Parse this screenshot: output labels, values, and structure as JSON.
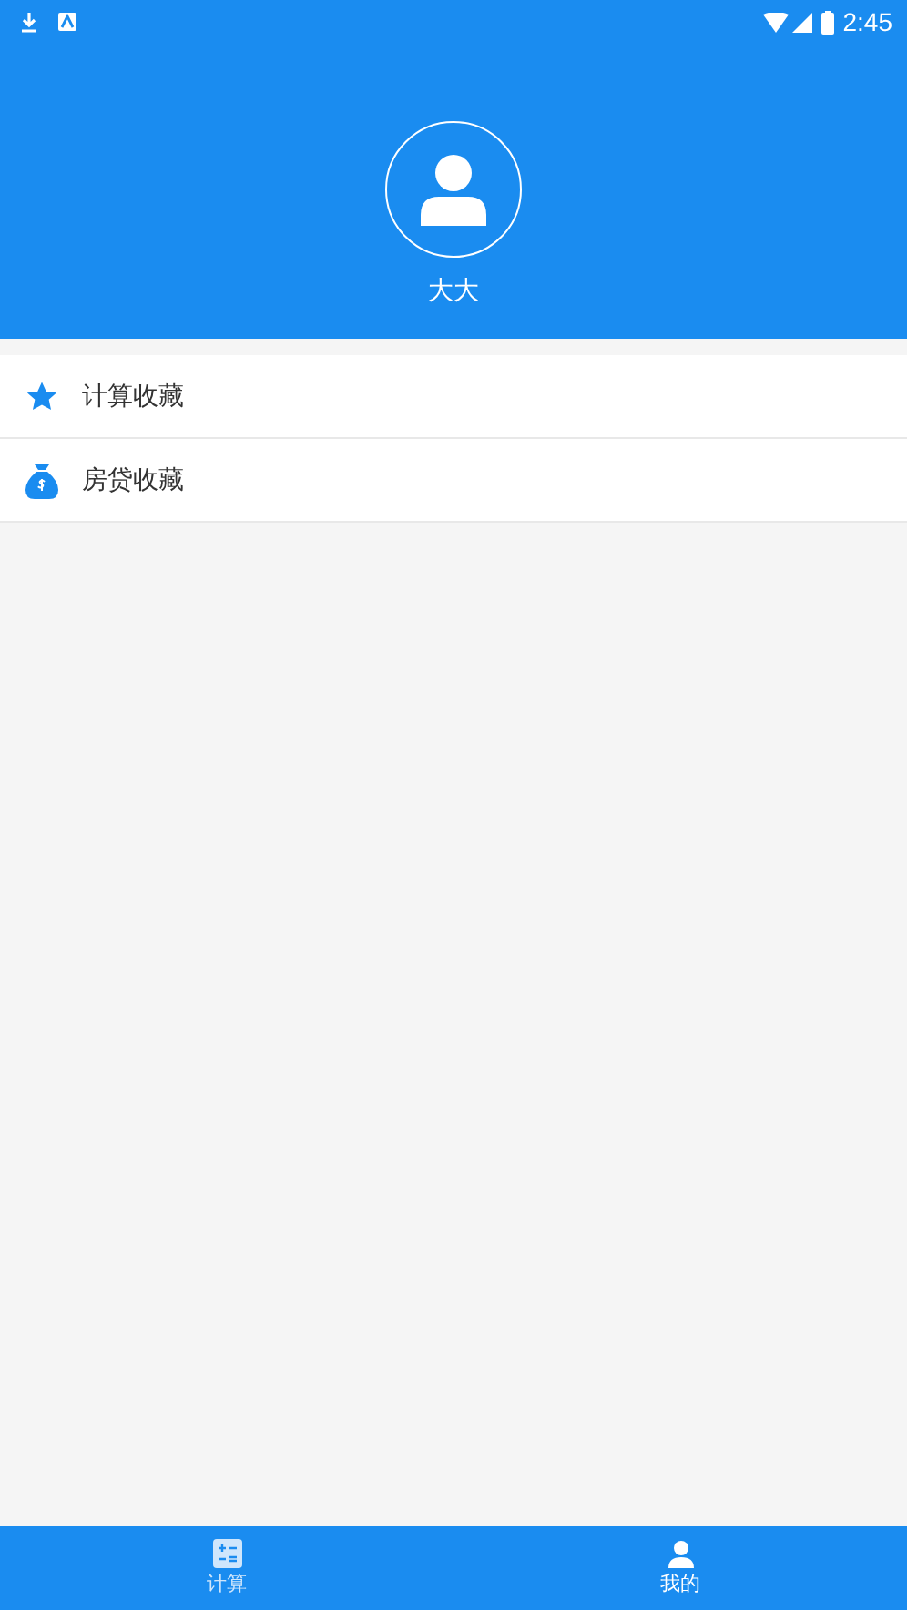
{
  "status_bar": {
    "time": "2:45"
  },
  "profile": {
    "name": "大大"
  },
  "menu": [
    {
      "label": "计算收藏",
      "kind": "star"
    },
    {
      "label": "房贷收藏",
      "kind": "moneybag"
    }
  ],
  "bottom_tabs": [
    {
      "label": "计算",
      "kind": "calculator",
      "selected": false
    },
    {
      "label": "我的",
      "kind": "person",
      "selected": true
    }
  ]
}
